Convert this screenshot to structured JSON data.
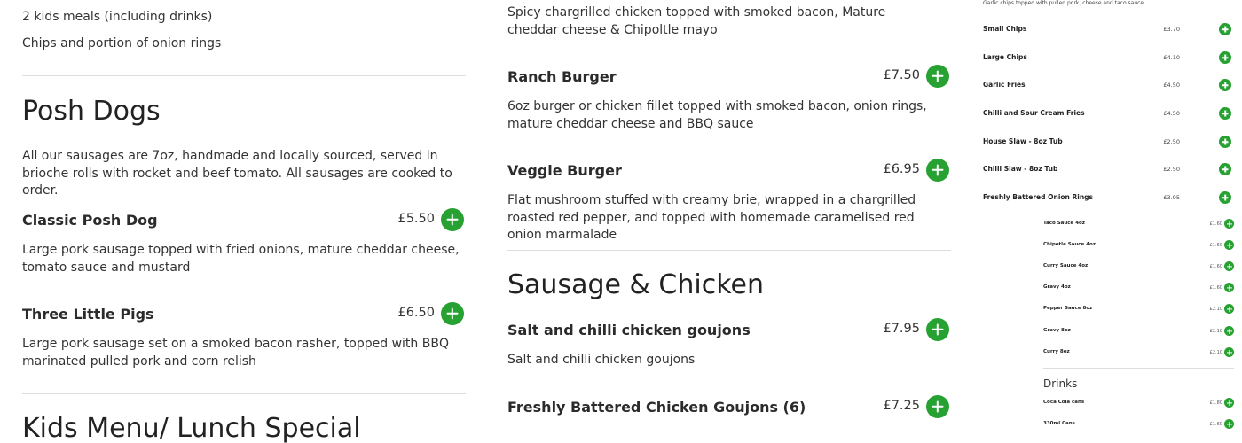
{
  "col1": {
    "kids_line1": "2 kids meals (including drinks)",
    "kids_line2": "Chips and portion of onion rings",
    "posh_dogs_heading": "Posh Dogs",
    "posh_dogs_intro": "All our sausages are 7oz, handmade and locally sourced, served in brioche rolls with rocket and beef tomato. All sausages are cooked to order.",
    "items": [
      {
        "name": "Classic Posh Dog",
        "price": "£5.50",
        "desc": "Large pork sausage topped with fried onions, mature cheddar cheese, tomato sauce and mustard"
      },
      {
        "name": "Three Little Pigs",
        "price": "£6.50",
        "desc": "Large pork sausage set on a smoked bacon rasher, topped with BBQ marinated pulled pork and corn relish"
      }
    ],
    "kids_heading": "Kids Menu/ Lunch Special"
  },
  "col2": {
    "top_desc": "Spicy chargrilled chicken topped with smoked bacon, Mature cheddar cheese & Chipoltle mayo",
    "burgers": [
      {
        "name": "Ranch Burger",
        "price": "£7.50",
        "desc": "6oz burger or chicken fillet topped with smoked bacon, onion rings, mature cheddar cheese and BBQ sauce"
      },
      {
        "name": "Veggie Burger",
        "price": "£6.95",
        "desc": "Flat mushroom stuffed with creamy brie, wrapped in a chargrilled roasted red pepper, and topped with homemade caramelised red onion marmalade"
      }
    ],
    "sausage_heading": "Sausage & Chicken",
    "chicken": [
      {
        "name": "Salt and chilli chicken goujons",
        "price": "£7.95",
        "desc": "Salt and chilli chicken goujons"
      },
      {
        "name": "Freshly Battered Chicken Goujons (6)",
        "price": "£7.25"
      }
    ]
  },
  "panel": {
    "note": "Garlic chips topped with pulled pork, cheese and taco sauce",
    "sides": [
      {
        "name": "Small Chips",
        "price": "£3.70"
      },
      {
        "name": "Large Chips",
        "price": "£4.10"
      },
      {
        "name": "Garlic Fries",
        "price": "£4.50"
      },
      {
        "name": "Chilli and Sour Cream Fries",
        "price": "£4.50"
      },
      {
        "name": "House Slaw - 8oz Tub",
        "price": "£2.50"
      },
      {
        "name": "Chilli Slaw - 8oz Tub",
        "price": "£2.50"
      },
      {
        "name": "Freshly Battered Onion Rings",
        "price": "£3.95"
      }
    ],
    "sauces": [
      {
        "name": "Taco Sauce 4oz",
        "price": "£1.60"
      },
      {
        "name": "Chipotle Sauce 4oz",
        "price": "£1.60"
      },
      {
        "name": "Curry Sauce 4oz",
        "price": "£1.60"
      },
      {
        "name": "Gravy 4oz",
        "price": "£1.60"
      },
      {
        "name": "Pepper Sauce 8oz",
        "price": "£2.10"
      },
      {
        "name": "Gravy 8oz",
        "price": "£2.10"
      },
      {
        "name": "Curry 8oz",
        "price": "£2.10"
      }
    ],
    "drinks_heading": "Drinks",
    "drinks": [
      {
        "name": "Coca Cola cans",
        "price": "£1.80"
      },
      {
        "name": "330ml Cans",
        "price": "£1.60"
      }
    ]
  },
  "colors": {
    "add_button": "#27a132",
    "divider": "#dddddd"
  },
  "icons": {
    "add": "plus-icon"
  }
}
